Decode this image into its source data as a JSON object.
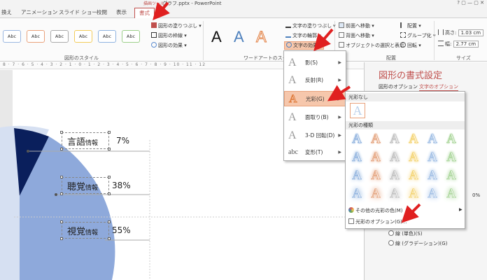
{
  "titlebar": {
    "context_tab_group": "描画ツール",
    "window_title": "グラフ.pptx - PowerPoint",
    "controls": "?  ▢  —  ▢  ✕"
  },
  "tabs": [
    {
      "label": "換え"
    },
    {
      "label": "アニメーション"
    },
    {
      "label": "スライド ショー"
    },
    {
      "label": "校閲"
    },
    {
      "label": "表示"
    },
    {
      "label": "書式"
    }
  ],
  "ribbon": {
    "shape_styles": {
      "group_label": "図形のスタイル",
      "swatch_label": "Abc",
      "fill": "図形の塗りつぶし",
      "outline": "図形の枠線",
      "effects": "図形の効果"
    },
    "wordart": {
      "group_label": "ワードアートのスタイル",
      "letter": "A",
      "text_fill": "文字の塗りつぶし",
      "text_outline": "文字の輪郭",
      "text_effects": "文字の効果"
    },
    "arrange": {
      "group_label": "配置",
      "bring_forward": "前面へ移動",
      "send_backward": "背面へ移動",
      "selection_pane": "オブジェクトの選択と表示",
      "align": "配置",
      "group": "グループ化",
      "rotate": "回転"
    },
    "size": {
      "group_label": "サイズ",
      "height_label": "高さ:",
      "height_value": "1.03 cm",
      "width_label": "幅:",
      "width_value": "2.77 cm"
    }
  },
  "ruler": "8 · 7 · 6 · 5 · 4 · 3 · 2 · 1 · 0 · 1 · 2 · 3 · 4 · 5 · 6 · 7 · 8 · 9 · 10 · 11 · 12",
  "slide": {
    "items": [
      {
        "name_main": "言語",
        "name_sub": "情報",
        "percent": "7%"
      },
      {
        "name_main": "聴覚",
        "name_sub": "情報",
        "percent": "38%"
      },
      {
        "name_main": "視覚",
        "name_sub": "情報",
        "percent": "55%"
      }
    ]
  },
  "taskpane": {
    "title": "図形の書式設定",
    "tab_shape_options": "図形のオプション",
    "tab_text_options": "文字のオプション",
    "radio_solid": "線 (単色)(S)",
    "radio_gradient": "線 (グラデーション)(G)",
    "side_value": "0%"
  },
  "text_effects_menu": {
    "items": [
      {
        "label": "影(S)",
        "glyph": "A"
      },
      {
        "label": "反射(R)",
        "glyph": "A"
      },
      {
        "label": "光彩(G)",
        "glyph": "A"
      },
      {
        "label": "面取り(B)",
        "glyph": "A"
      },
      {
        "label": "3-D 回転(D)",
        "glyph": "A"
      },
      {
        "label": "変形(T)",
        "glyph": "abc"
      }
    ]
  },
  "glow_menu": {
    "no_glow_header": "光彩なし",
    "variants_header": "光彩の種類",
    "more_colors": "その他の光彩の色(M)",
    "glow_options": "光彩のオプション(G)...",
    "swatch_glyph": "A",
    "glow_colors": [
      "#7fa7d9",
      "#e0956a",
      "#b4b4b4",
      "#f2cc5a",
      "#8fb3e0",
      "#9ccf8a"
    ]
  },
  "colors": {
    "accent": "#c0504d",
    "pie_dark": "#0a1f5c",
    "pie_mid": "#8ea9db",
    "pie_light": "#d6e0f2",
    "highlight": "#f6c7ac"
  }
}
